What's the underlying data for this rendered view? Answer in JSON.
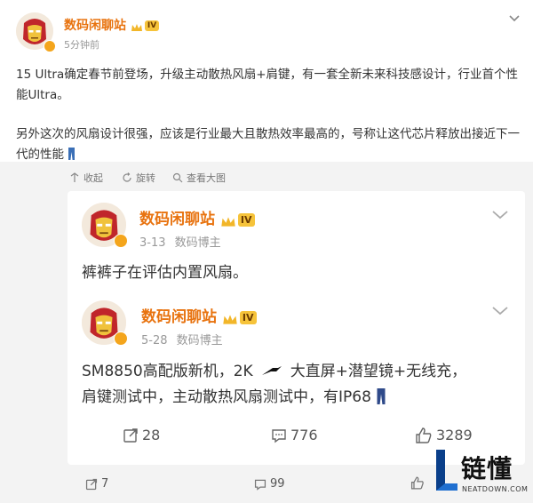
{
  "post": {
    "author": "数码闲聊站",
    "level": "IV",
    "time": "5分钟前",
    "line1": "15 Ultra确定春节前登场，升级主动散热风扇+肩键，有一套全新未来科技感设计，行业首个性能Ultra。",
    "line2": "另外这次的风扇设计很强，应该是行业最大且散热效率最高的，号称让这代芯片释放出接近下一代的性能",
    "actions": {
      "collect": "收起",
      "repost": "旋转",
      "viewlarge": "查看大图"
    }
  },
  "quote1": {
    "author": "数码闲聊站",
    "level": "IV",
    "date": "3-13",
    "role": "数码博主",
    "text": "裤裤子在评估内置风扇。"
  },
  "quote2": {
    "author": "数码闲聊站",
    "level": "IV",
    "date": "5-28",
    "role": "数码博主",
    "text_line1": "SM8850高配版新机，2K",
    "text_line1b": "大直屏+潜望镜+无线充，",
    "text_line2": "肩键测试中，主动散热风扇测试中，有IP68",
    "repost_count": "28",
    "comment_count": "776",
    "like_count": "3289"
  },
  "footer": {
    "repost_count": "7",
    "comment_count": "99"
  },
  "watermark": {
    "brand": "链懂",
    "url": "NEATDOWN.COM"
  }
}
